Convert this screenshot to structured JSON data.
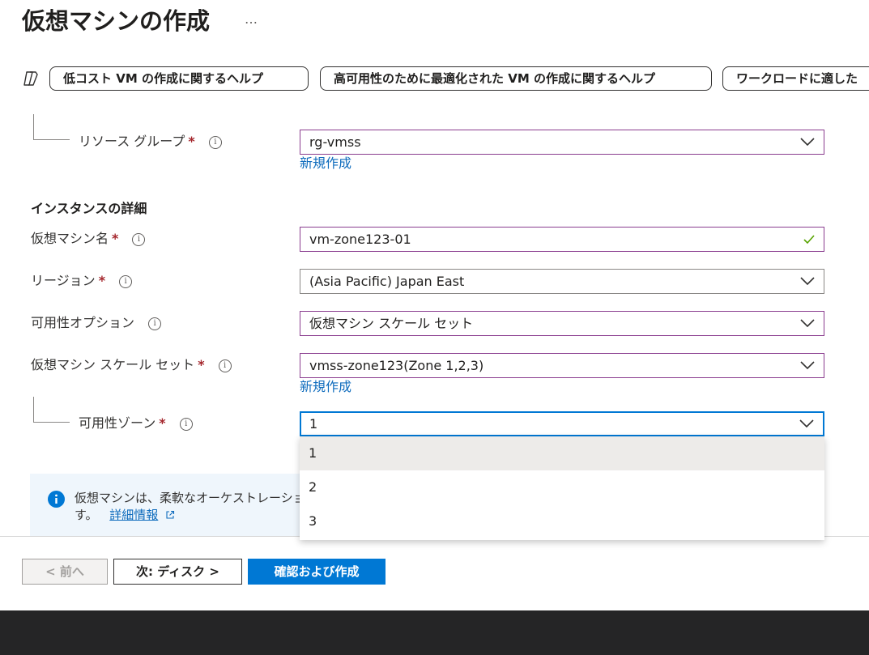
{
  "header": {
    "title": "仮想マシンの作成",
    "more": "…"
  },
  "prompts": {
    "icon": "copilot-icon",
    "chips": [
      "低コスト VM の作成に関するヘルプ",
      "高可用性のために最適化された VM の作成に関するヘルプ",
      "ワークロードに適した"
    ]
  },
  "form": {
    "resource_group": {
      "label": "リソース グループ",
      "required": "*",
      "value": "rg-vmss",
      "create_new": "新規作成"
    },
    "instance_section": "インスタンスの詳細",
    "vm_name": {
      "label": "仮想マシン名",
      "required": "*",
      "value": "vm-zone123-01",
      "status_icon": "checkmark-icon"
    },
    "region": {
      "label": "リージョン",
      "required": "*",
      "value": "(Asia Pacific) Japan East"
    },
    "availability_option": {
      "label": "可用性オプション",
      "value": "仮想マシン スケール セット"
    },
    "scale_set": {
      "label": "仮想マシン スケール セット",
      "required": "*",
      "value": "vmss-zone123(Zone 1,2,3)",
      "create_new": "新規作成"
    },
    "zone": {
      "label": "可用性ゾーン",
      "required": "*",
      "value": "1",
      "options": [
        "1",
        "2",
        "3"
      ]
    }
  },
  "infobar": {
    "line1": "仮想マシンは、柔軟なオーケストレーショ",
    "line2_prefix": "す。",
    "link": "詳細情報"
  },
  "buttons": {
    "prev": "< 前へ",
    "next": "次: ディスク >",
    "review": "確認および作成"
  },
  "colors": {
    "accent": "#0078d4",
    "link": "#0f6cbd",
    "required": "#a4262c",
    "field_border": "#8a3d8f",
    "valid": "#57a300"
  }
}
